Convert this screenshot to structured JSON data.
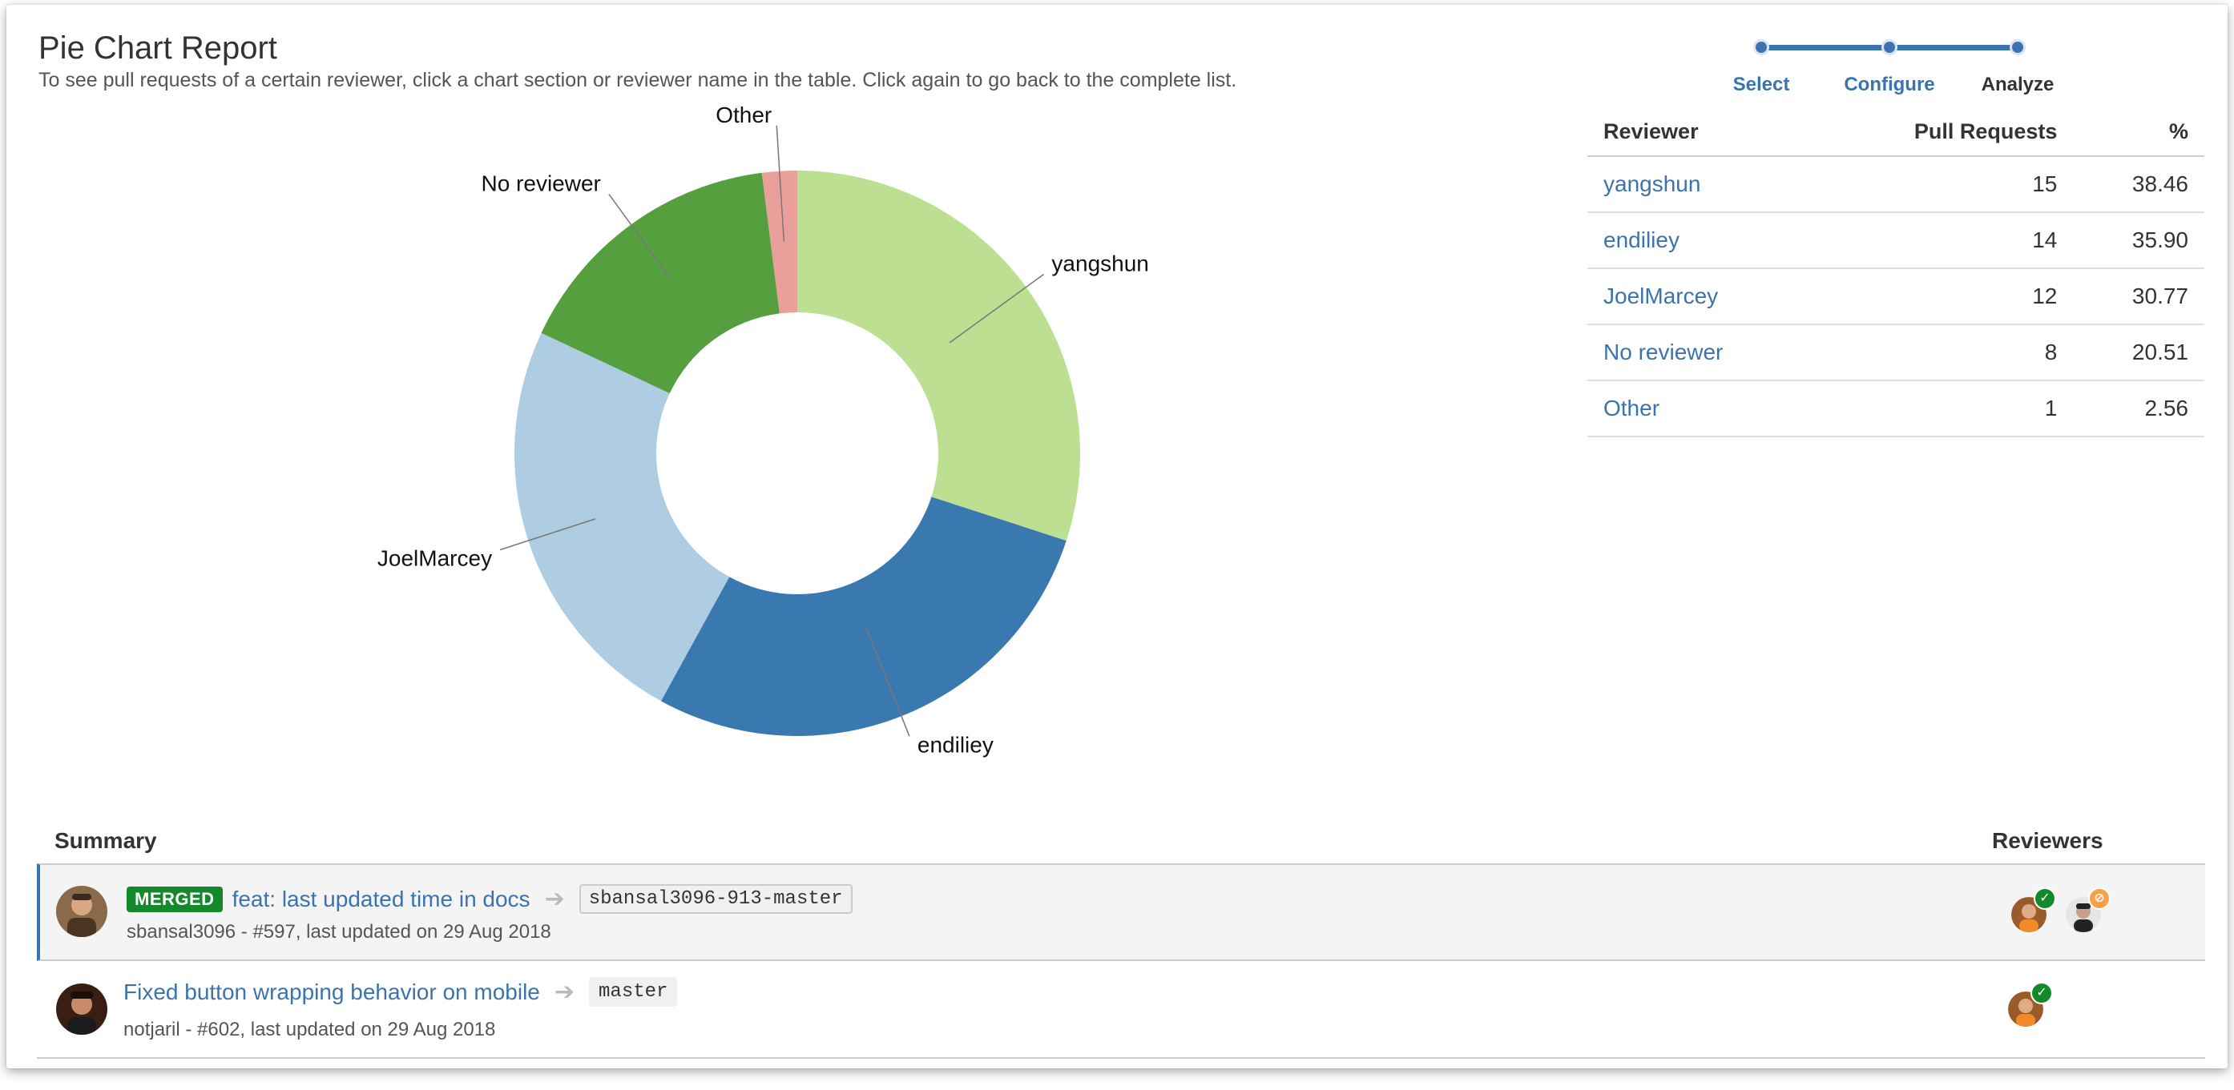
{
  "page": {
    "title": "Pie Chart Report",
    "subtitle": "To see pull requests of a certain reviewer, click a chart section or reviewer name in the table. Click again to go back to the complete list."
  },
  "wizard": {
    "steps": [
      {
        "label": "Select",
        "state": "done"
      },
      {
        "label": "Configure",
        "state": "done"
      },
      {
        "label": "Analyze",
        "state": "current"
      }
    ]
  },
  "table": {
    "headers": {
      "reviewer": "Reviewer",
      "pull_requests": "Pull Requests",
      "percent": "%"
    },
    "rows": [
      {
        "reviewer": "yangshun",
        "pull_requests": "15",
        "percent": "38.46"
      },
      {
        "reviewer": "endiliey",
        "pull_requests": "14",
        "percent": "35.90"
      },
      {
        "reviewer": "JoelMarcey",
        "pull_requests": "12",
        "percent": "30.77"
      },
      {
        "reviewer": "No reviewer",
        "pull_requests": "8",
        "percent": "20.51"
      },
      {
        "reviewer": "Other",
        "pull_requests": "1",
        "percent": "2.56"
      }
    ]
  },
  "chart_data": {
    "type": "pie",
    "donut": true,
    "categories": [
      "yangshun",
      "endiliey",
      "JoelMarcey",
      "No reviewer",
      "Other"
    ],
    "values": [
      15,
      14,
      12,
      8,
      1
    ],
    "colors": [
      "#bcdf92",
      "#3a78b0",
      "#aecde3",
      "#559f3e",
      "#eb9f9a"
    ],
    "start": "12 o'clock, clockwise",
    "labels_outside": true
  },
  "summary": {
    "header": "Summary",
    "reviewers_header": "Reviewers",
    "rows": [
      {
        "status": "MERGED",
        "title": "feat: last updated time in docs",
        "branch": "sbansal3096-913-master",
        "meta": "sbansal3096 - #597, last updated on 29 Aug 2018",
        "reviewers": [
          {
            "badge": "approved",
            "badge_icon": "check-icon"
          },
          {
            "badge": "needs-work",
            "badge_icon": "no-entry-icon"
          }
        ]
      },
      {
        "status": "",
        "title": "Fixed button wrapping behavior on mobile",
        "branch": "master",
        "meta": "notjaril - #602, last updated on 29 Aug 2018",
        "reviewers": [
          {
            "badge": "approved",
            "badge_icon": "check-icon"
          }
        ]
      }
    ]
  },
  "colors": {
    "link": "#3b73af",
    "merged": "#14892c",
    "needs_work": "#f6a04a"
  }
}
